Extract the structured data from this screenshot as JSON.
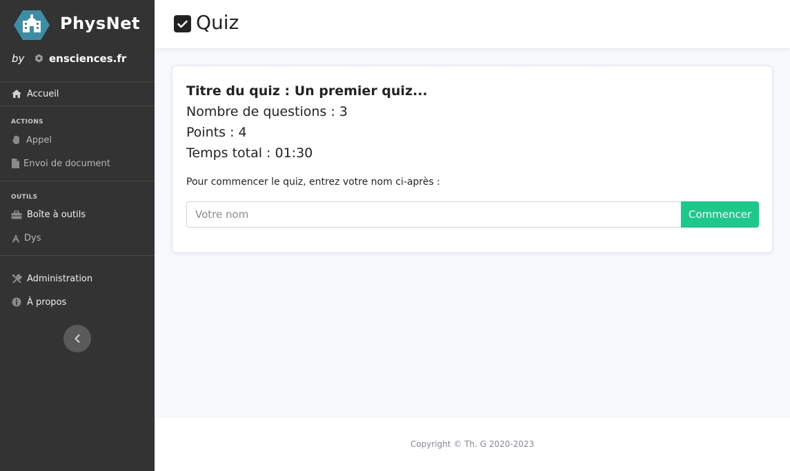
{
  "brand": {
    "name": "PhysNet",
    "by_label": "by",
    "site": "ensciences.fr"
  },
  "sidebar": {
    "home": {
      "label": "Accueil",
      "icon": "home-icon"
    },
    "sections": [
      {
        "heading": "ACTIONS",
        "items": [
          {
            "label": "Appel",
            "icon": "hand-icon"
          },
          {
            "label": "Envoi de document",
            "icon": "file-icon"
          }
        ]
      },
      {
        "heading": "OUTILS",
        "items": [
          {
            "label": "Boîte à outils",
            "icon": "toolbox-icon"
          },
          {
            "label": "Dys",
            "icon": "font-icon"
          }
        ]
      }
    ],
    "bottom_items": [
      {
        "label": "Administration",
        "icon": "tools-icon"
      },
      {
        "label": "À propos",
        "icon": "info-icon"
      }
    ],
    "toggle_icon": "chevron-left-icon"
  },
  "header": {
    "title": "Quiz",
    "icon": "check-square-icon"
  },
  "quiz": {
    "title_line": "Titre du quiz : Un premier quiz...",
    "questions_line": "Nombre de questions : 3",
    "points_line": "Points : 4",
    "time_line": "Temps total : 01:30",
    "prompt": "Pour commencer le quiz, entrez votre nom ci-après :",
    "name_placeholder": "Votre nom",
    "name_value": "",
    "start_label": "Commencer"
  },
  "footer": {
    "copyright": "Copyright © Th. G 2020-2023"
  },
  "colors": {
    "sidebar_bg": "#333333",
    "accent_button": "#1cc88a",
    "logo_teal": "#3b8ea5"
  }
}
